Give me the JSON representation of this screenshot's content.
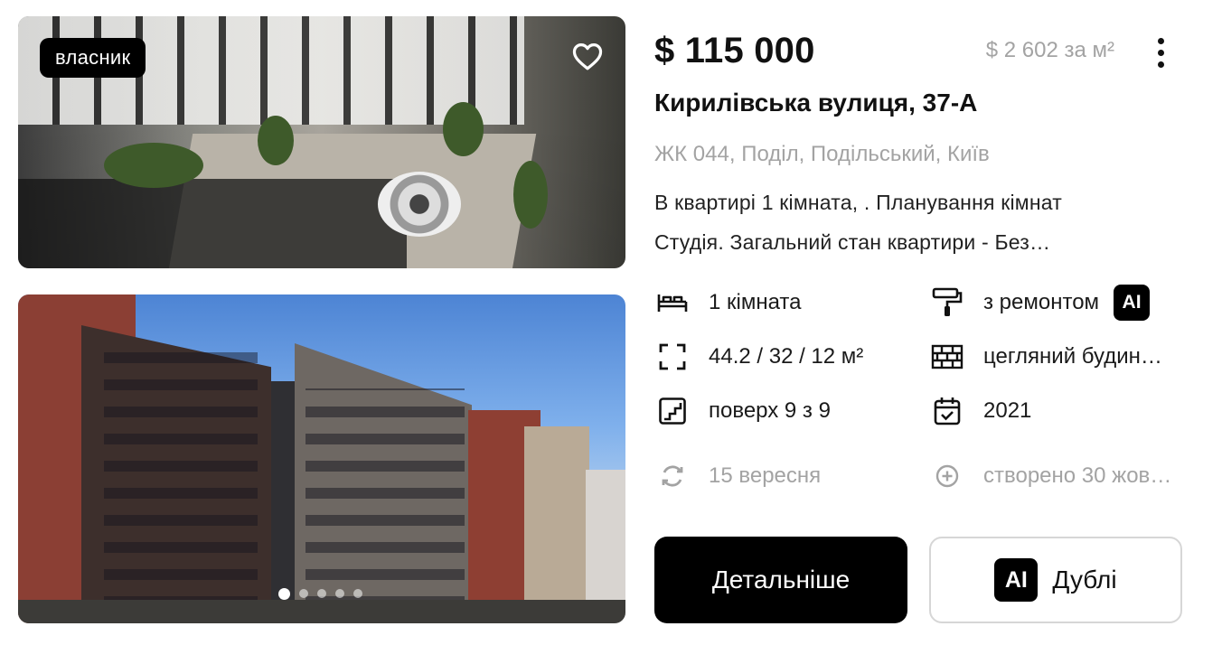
{
  "listing": {
    "owner_badge": "власник",
    "price": "$ 115 000",
    "price_per_sqm": "$ 2 602 за м²",
    "address": "Кирилівська вулиця, 37-А",
    "complex": "ЖК 044, Поділ, Подільський, Київ",
    "description_line1": "В квартирі 1 кімната, . Планування кімнат",
    "description_line2": "Студія. Загальний стан квартири - Без…",
    "features": {
      "rooms": "1 кімната",
      "area": "44.2 / 32 / 12 м²",
      "floor": "поверх 9 з 9",
      "updated": "15 вересня",
      "condition": "з ремонтом",
      "condition_badge": "AI",
      "building_type": "цегляний будин…",
      "year": "2021",
      "created": "створено 30 жов…"
    },
    "buttons": {
      "details": "Детальніше",
      "duplicates": "Дублі",
      "duplicates_badge": "AI"
    },
    "gallery": {
      "photo_count": 5,
      "active_index": 0
    }
  },
  "icons": {
    "favorite": "heart-icon",
    "more": "more-vertical-icon",
    "rooms": "bed-icon",
    "area": "area-frame-icon",
    "floor": "stairs-icon",
    "updated": "refresh-icon",
    "condition": "paint-roller-icon",
    "building_type": "brick-wall-icon",
    "year": "calendar-check-icon",
    "created": "plus-circle-icon"
  },
  "colors": {
    "primary": "#000000",
    "muted_text": "#a3a3a3",
    "border": "#d6d6d6"
  }
}
